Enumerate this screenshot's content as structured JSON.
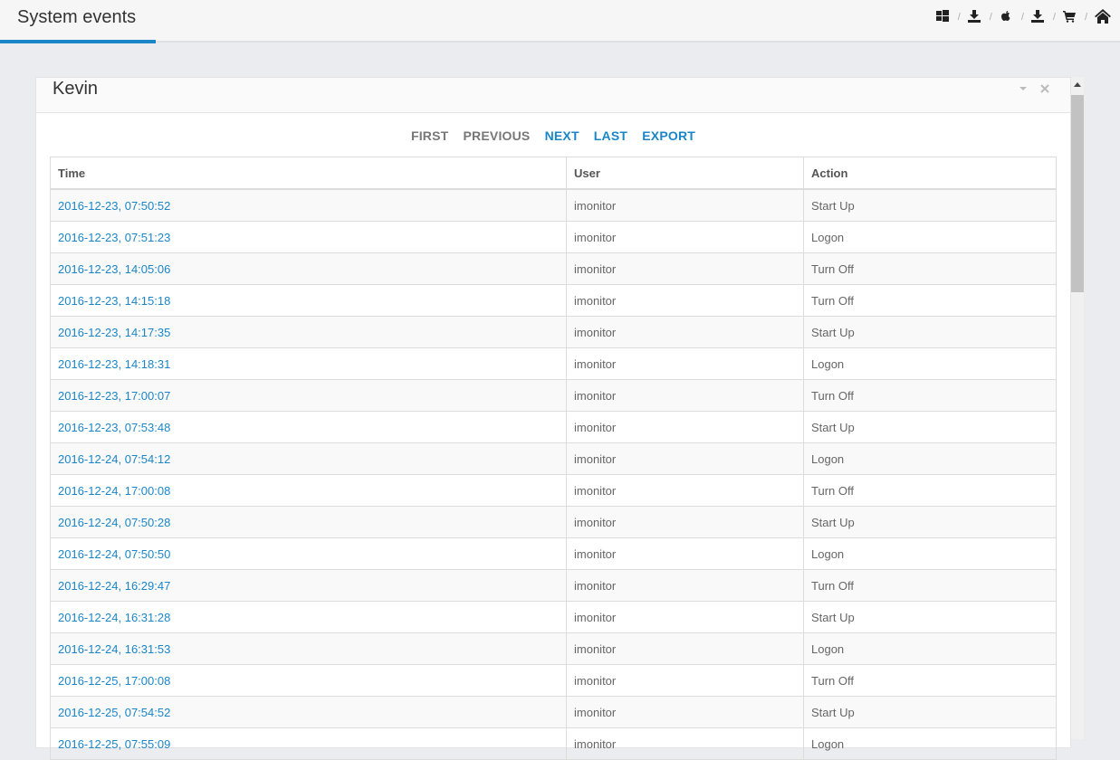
{
  "header": {
    "title": "System events",
    "icons": [
      "windows-icon",
      "download-icon",
      "apple-icon",
      "download-icon",
      "cart-icon",
      "home-icon"
    ]
  },
  "panel": {
    "title": "Kevin",
    "pager": {
      "first": "FIRST",
      "previous": "PREVIOUS",
      "next": "NEXT",
      "last": "LAST",
      "export": "EXPORT"
    },
    "columns": [
      "Time",
      "User",
      "Action"
    ],
    "rows": [
      [
        "2016-12-23, 07:50:52",
        "imonitor",
        "Start Up"
      ],
      [
        "2016-12-23, 07:51:23",
        "imonitor",
        "Logon"
      ],
      [
        "2016-12-23, 14:05:06",
        "imonitor",
        "Turn Off"
      ],
      [
        "2016-12-23, 14:15:18",
        "imonitor",
        "Turn Off"
      ],
      [
        "2016-12-23, 14:17:35",
        "imonitor",
        "Start Up"
      ],
      [
        "2016-12-23, 14:18:31",
        "imonitor",
        "Logon"
      ],
      [
        "2016-12-23, 17:00:07",
        "imonitor",
        "Turn Off"
      ],
      [
        "2016-12-23, 07:53:48",
        "imonitor",
        "Start Up"
      ],
      [
        "2016-12-24, 07:54:12",
        "imonitor",
        "Logon"
      ],
      [
        "2016-12-24, 17:00:08",
        "imonitor",
        "Turn Off"
      ],
      [
        "2016-12-24, 07:50:28",
        "imonitor",
        "Start Up"
      ],
      [
        "2016-12-24, 07:50:50",
        "imonitor",
        "Logon"
      ],
      [
        "2016-12-24, 16:29:47",
        "imonitor",
        "Turn Off"
      ],
      [
        "2016-12-24, 16:31:28",
        "imonitor",
        "Start Up"
      ],
      [
        "2016-12-24, 16:31:53",
        "imonitor",
        "Logon"
      ],
      [
        "2016-12-25, 17:00:08",
        "imonitor",
        "Turn Off"
      ],
      [
        "2016-12-25, 07:54:52",
        "imonitor",
        "Start Up"
      ],
      [
        "2016-12-25, 07:55:09",
        "imonitor",
        "Logon"
      ]
    ]
  },
  "colors": {
    "accent": "#1a86c8",
    "background": "#ebecef"
  }
}
